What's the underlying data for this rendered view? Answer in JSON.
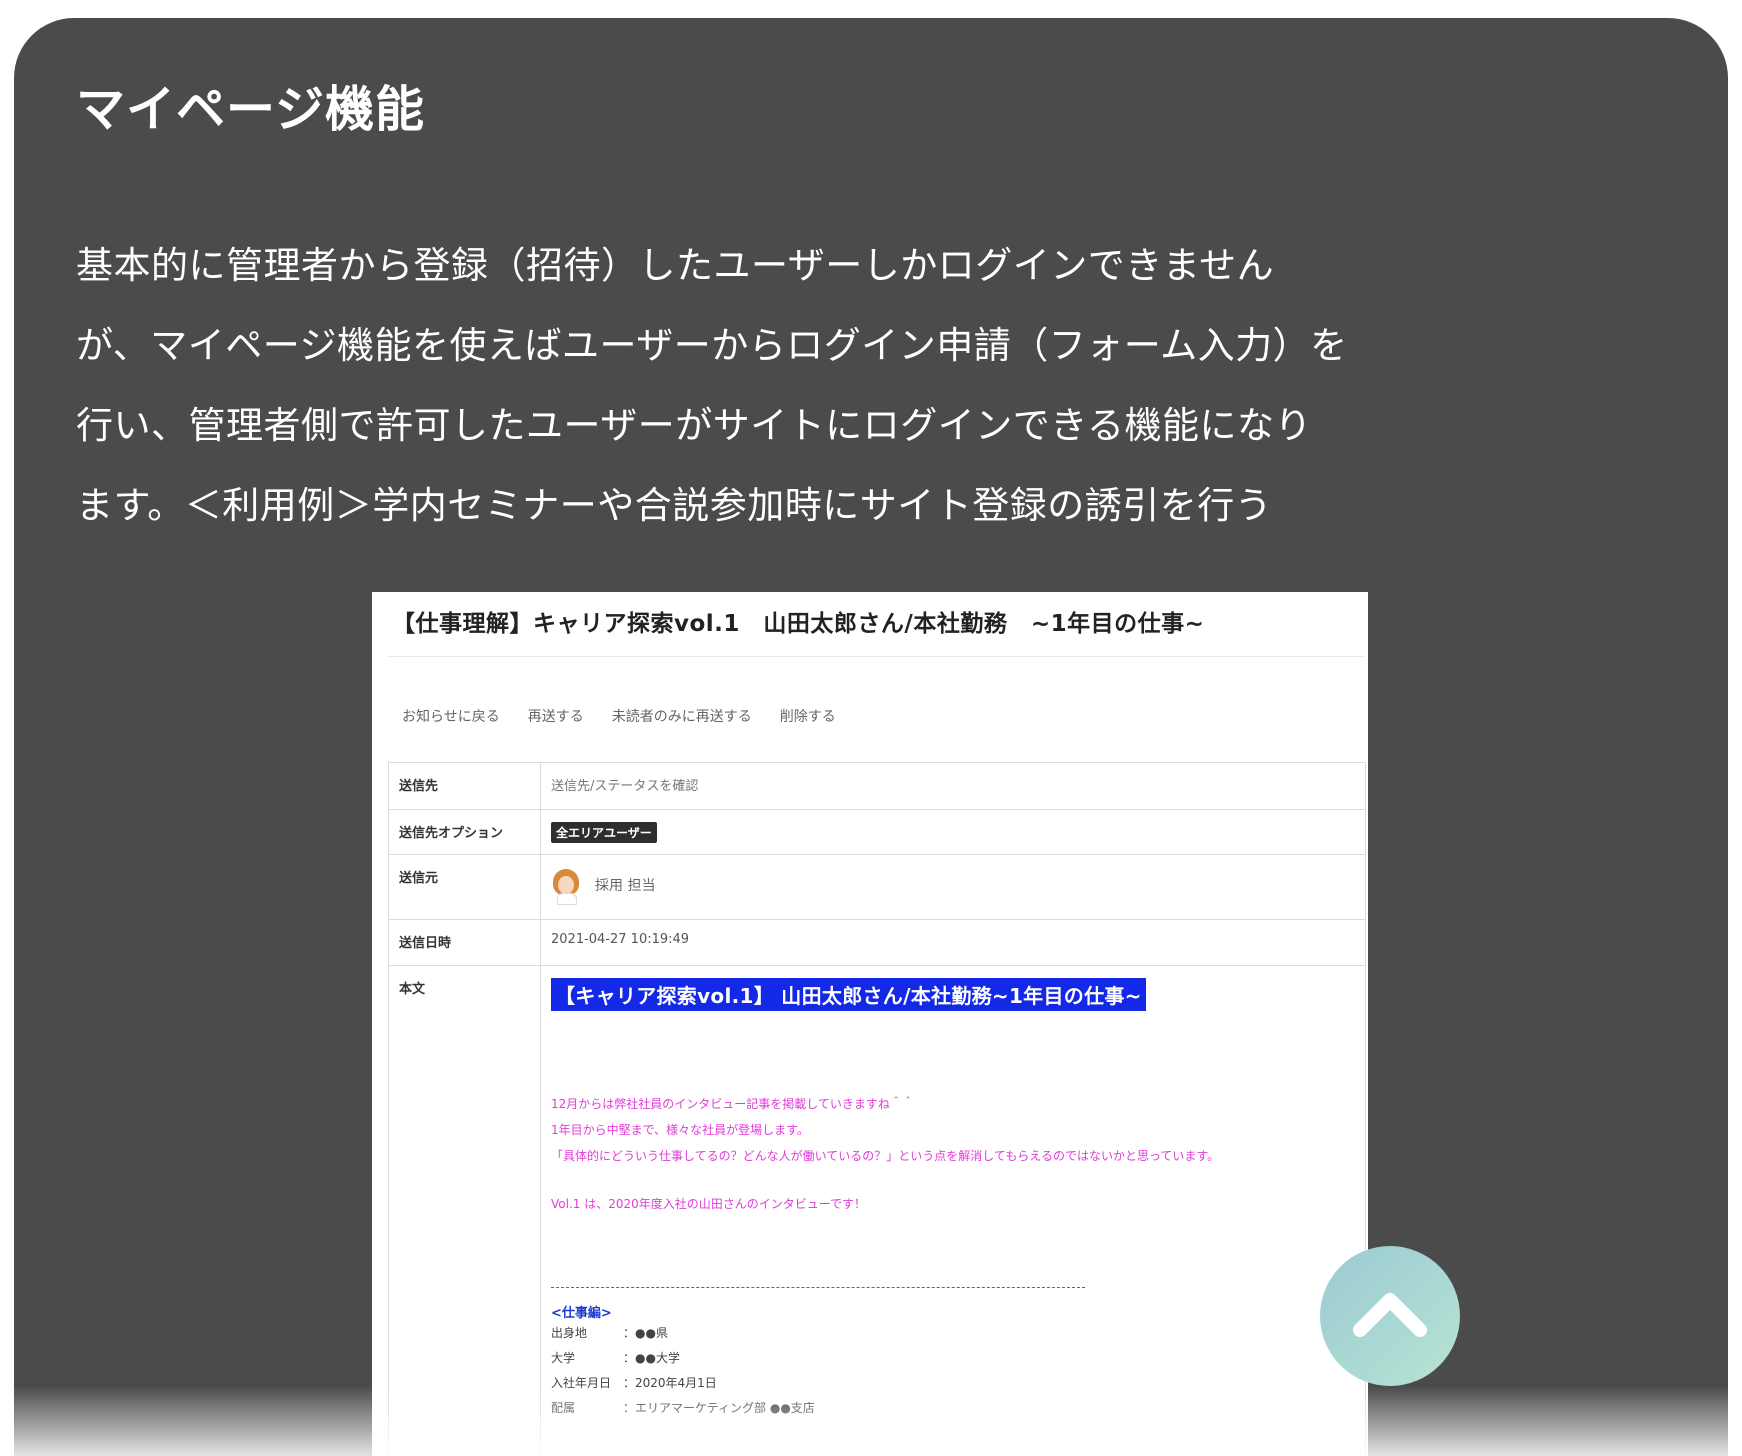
{
  "section": {
    "title": "マイページ機能",
    "description_lines": [
      "基本的に管理者から登録（招待）したユーザーしかログインできません",
      "が、マイページ機能を使えばユーザーからログイン申請（フォーム入力）を",
      "行い、管理者側で許可したユーザーがサイトにログインできる機能になり",
      "ます。＜利用例＞学内セミナーや合説参加時にサイト登録の誘引を行う"
    ]
  },
  "screenshot": {
    "title": "【仕事理解】キャリア探索vol.1　山田太郎さん/本社勤務　~1年目の仕事~",
    "actions": [
      "お知らせに戻る",
      "再送する",
      "未読者のみに再送する",
      "削除する"
    ],
    "fields": {
      "recipient_label": "送信先",
      "recipient_value": "送信先/ステータスを確認",
      "option_label": "送信先オプション",
      "option_badge": "全エリアユーザー",
      "sender_label": "送信元",
      "sender_name": "採用 担当",
      "datetime_label": "送信日時",
      "datetime_value": "2021-04-27 10:19:49",
      "body_label": "本文"
    },
    "body": {
      "heading": "【キャリア探索vol.1】 山田太郎さん/本社勤務~1年目の仕事~",
      "paragraph_lines": [
        "12月からは弊社社員のインタビュー記事を掲載していきますね＾＾",
        "1年目から中堅まで、様々な社員が登場します。",
        "「具体的にどういう仕事してるの？どんな人が働いているの？」という点を解消してもらえるのではないかと思っています。"
      ],
      "vol_line": "Vol.1 は、2020年度入社の山田さんのインタビューです！",
      "info_heading": "<仕事編>",
      "info": [
        {
          "key": "出身地",
          "value": "：●●県"
        },
        {
          "key": "大学",
          "value": "：●●大学"
        },
        {
          "key": "入社年月日",
          "value": "：2020年4月1日"
        },
        {
          "key": "配属",
          "value": "：エリアマーケティング部 ●●支店"
        }
      ]
    }
  },
  "colors": {
    "card_background": "#4b4b4b",
    "highlight_blue": "#1428e8",
    "pink_text": "#e23bd8",
    "scroll_button": "#a9d8d3"
  },
  "icons": {
    "scroll_top": "chevron-up-icon"
  }
}
